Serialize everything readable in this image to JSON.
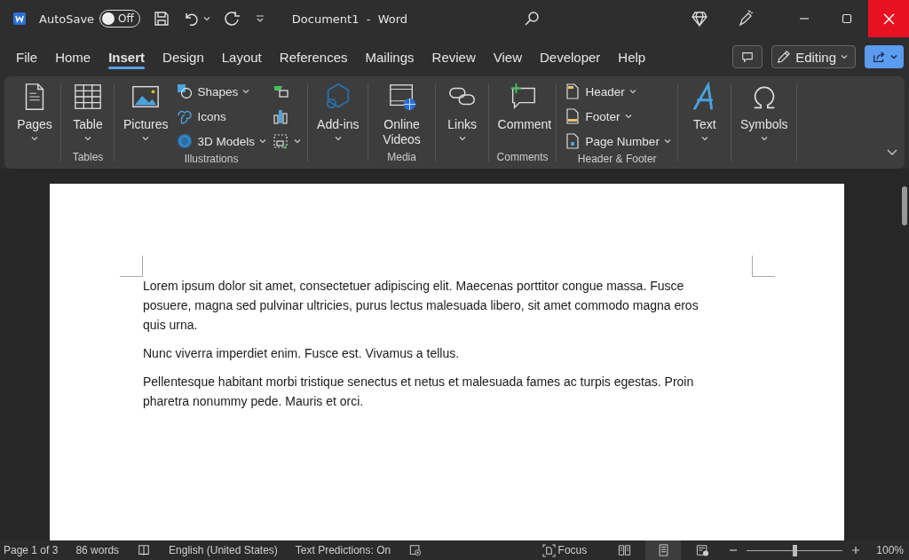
{
  "title_bar": {
    "autosave": {
      "label": "AutoSave",
      "state_text": "Off",
      "on": false
    },
    "title": "Document1  -  Word"
  },
  "tabs": [
    {
      "label": "File",
      "selected": false
    },
    {
      "label": "Home",
      "selected": false
    },
    {
      "label": "Insert",
      "selected": true
    },
    {
      "label": "Design",
      "selected": false
    },
    {
      "label": "Layout",
      "selected": false
    },
    {
      "label": "References",
      "selected": false
    },
    {
      "label": "Mailings",
      "selected": false
    },
    {
      "label": "Review",
      "selected": false
    },
    {
      "label": "View",
      "selected": false
    },
    {
      "label": "Developer",
      "selected": false
    },
    {
      "label": "Help",
      "selected": false
    }
  ],
  "editing_button": {
    "label": "Editing"
  },
  "ribbon": {
    "groups": [
      {
        "columns": [
          [
            {
              "kind": "large",
              "label": "Pages",
              "dropdown": true
            }
          ]
        ]
      },
      {
        "label": "Tables",
        "columns": [
          [
            {
              "kind": "large",
              "label": "Table",
              "dropdown": true
            }
          ]
        ]
      },
      {
        "label": "Illustrations",
        "columns": [
          [
            {
              "kind": "large",
              "label": "Pictures",
              "dropdown": true
            }
          ],
          [
            {
              "kind": "small",
              "label": "Shapes",
              "dropdown": true
            },
            {
              "kind": "small",
              "label": "Icons",
              "dropdown": false
            },
            {
              "kind": "small",
              "label": "3D Models",
              "dropdown": true
            }
          ],
          [
            {
              "kind": "icon",
              "dropdown": false
            },
            {
              "kind": "icon",
              "dropdown": false
            },
            {
              "kind": "icon",
              "dropdown": true
            }
          ]
        ]
      },
      {
        "columns": [
          [
            {
              "kind": "large",
              "label": "Add-ins",
              "dropdown": true
            }
          ]
        ]
      },
      {
        "label": "Media",
        "columns": [
          [
            {
              "kind": "large",
              "label": "Online Videos",
              "dropdown": false
            }
          ]
        ]
      },
      {
        "columns": [
          [
            {
              "kind": "large",
              "label": "Links",
              "dropdown": true
            }
          ]
        ]
      },
      {
        "label": "Comments",
        "columns": [
          [
            {
              "kind": "large",
              "label": "Comment",
              "dropdown": false
            }
          ]
        ]
      },
      {
        "label": "Header & Footer",
        "columns": [
          [
            {
              "kind": "small",
              "label": "Header",
              "dropdown": true
            },
            {
              "kind": "small",
              "label": "Footer",
              "dropdown": true
            },
            {
              "kind": "small",
              "label": "Page Number",
              "dropdown": true
            }
          ]
        ]
      },
      {
        "columns": [
          [
            {
              "kind": "large",
              "label": "Text",
              "dropdown": true
            }
          ]
        ]
      },
      {
        "columns": [
          [
            {
              "kind": "large",
              "label": "Symbols",
              "dropdown": true
            }
          ]
        ]
      }
    ]
  },
  "document": {
    "paragraphs": [
      "Lorem ipsum dolor sit amet, consectetuer adipiscing elit. Maecenas porttitor congue massa. Fusce posuere, magna sed pulvinar ultricies, purus lectus malesuada libero, sit amet commodo magna eros quis urna.",
      "Nunc viverra imperdiet enim. Fusce est. Vivamus a tellus.",
      "Pellentesque habitant morbi tristique senectus et netus et malesuada fames ac turpis egestas. Proin pharetra nonummy pede. Mauris et orci."
    ]
  },
  "status_bar": {
    "page": "Page 1 of 3",
    "words": "86 words",
    "language": "English (United States)",
    "predictions": "Text Predictions: On",
    "focus": "Focus",
    "views": [
      {
        "selected": false
      },
      {
        "selected": true
      },
      {
        "selected": false
      }
    ],
    "zoom": {
      "level": 0.5,
      "reading": "100%"
    }
  }
}
